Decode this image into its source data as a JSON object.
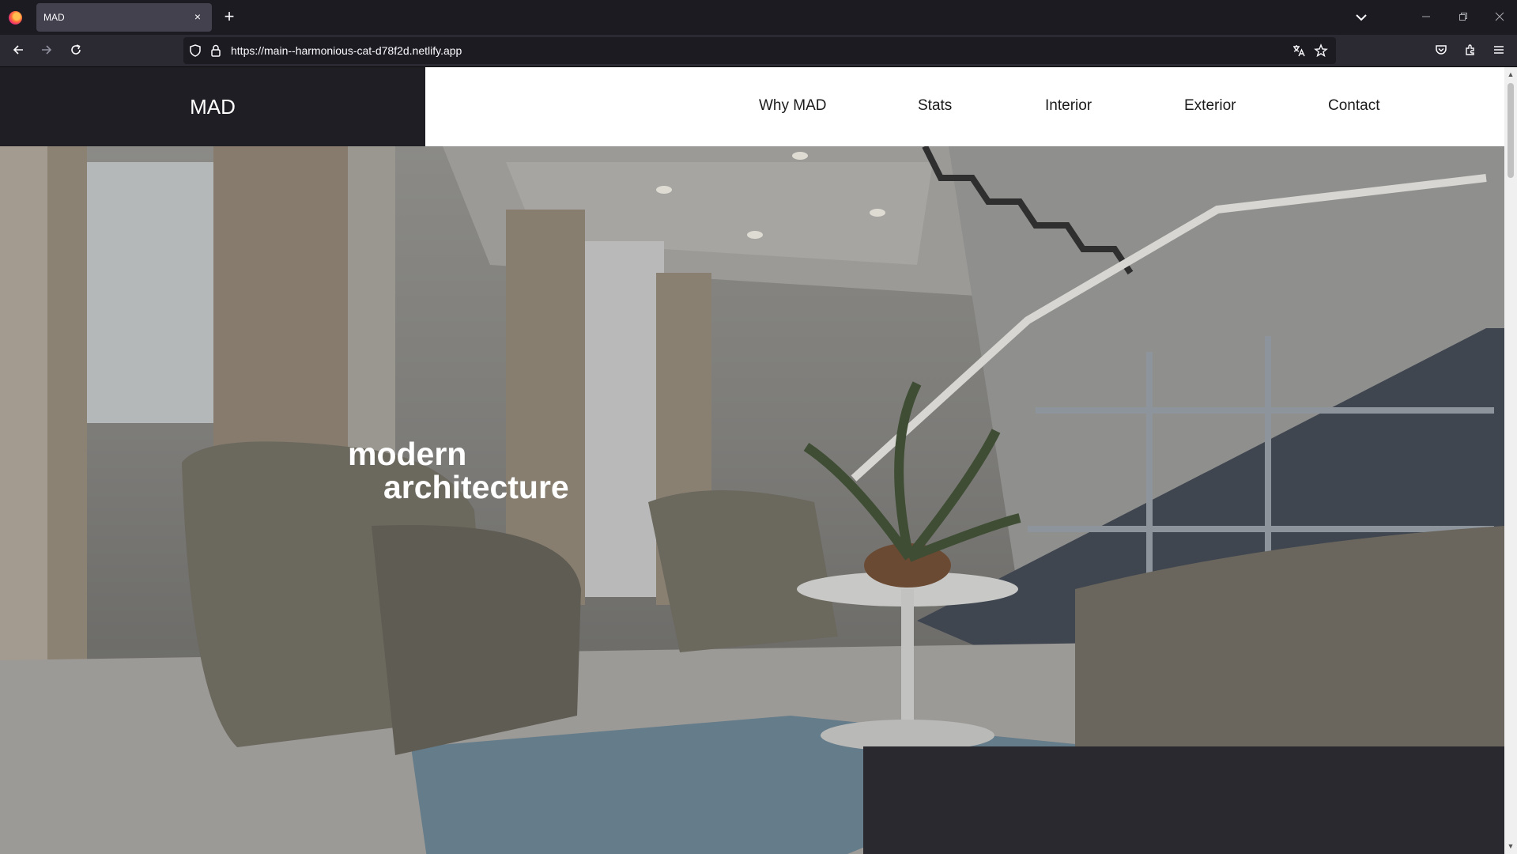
{
  "browser": {
    "tab_title": "MAD",
    "tab_close": "×",
    "new_tab": "+",
    "url": "https://main--harmonious-cat-d78f2d.netlify.app",
    "icons": [
      "firefox-logo",
      "back-arrow",
      "forward-arrow",
      "reload",
      "shield",
      "lock",
      "translate",
      "bookmark-star",
      "pocket",
      "extensions",
      "menu",
      "list-all-tabs",
      "minimize",
      "restore",
      "close"
    ]
  },
  "site": {
    "brand": "MAD",
    "menu": [
      {
        "label": "Why MAD"
      },
      {
        "label": "Stats"
      },
      {
        "label": "Interior"
      },
      {
        "label": "Exterior"
      },
      {
        "label": "Contact"
      }
    ],
    "hero": {
      "line1": "modern",
      "line2": "architecture"
    }
  },
  "colors": {
    "header_dark": "#1f1e24",
    "menu_bg": "#ffffff",
    "page_dark": "#2a2930"
  }
}
